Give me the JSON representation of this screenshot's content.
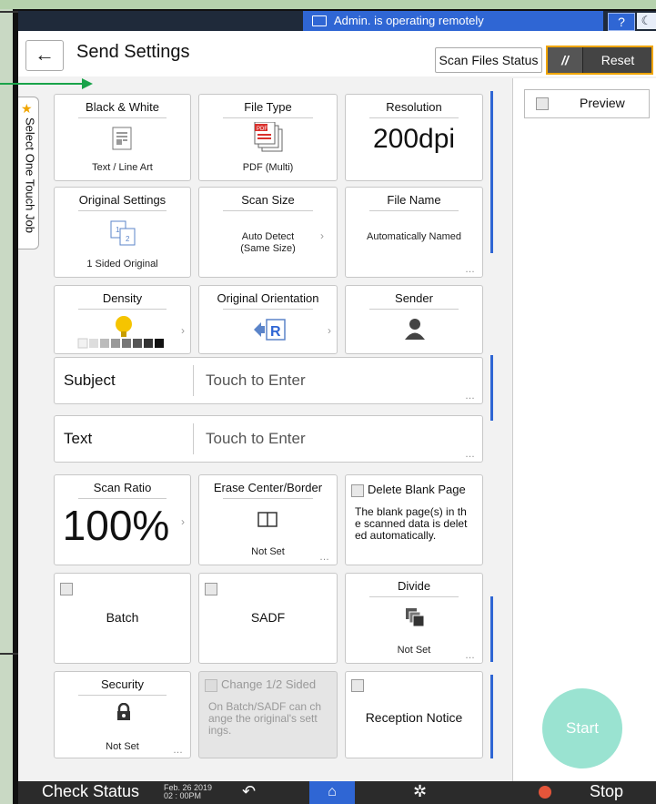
{
  "status_bar": {
    "remote_text": "Admin. is operating remotely",
    "help": "?",
    "moon": "☾"
  },
  "header": {
    "back": "←",
    "title": "Send Settings",
    "scan_files_status": "Scan Files Status",
    "reset": "Reset"
  },
  "side_tab": {
    "label": "Select One Touch Job"
  },
  "tiles": {
    "bw": {
      "title": "Black & White",
      "sub": "Text / Line Art"
    },
    "filetype": {
      "title": "File Type",
      "sub": "PDF (Multi)",
      "pdf": "PDF"
    },
    "resolution": {
      "title": "Resolution",
      "value": "200dpi"
    },
    "original": {
      "title": "Original Settings",
      "sub": "1 Sided Original",
      "n1": "1",
      "n2": "2"
    },
    "scansize": {
      "title": "Scan Size",
      "sub1": "Auto Detect",
      "sub2": "(Same Size)"
    },
    "filename": {
      "title": "File Name",
      "sub": "Automatically Named"
    },
    "density": {
      "title": "Density"
    },
    "orientation": {
      "title": "Original Orientation",
      "glyph": "R"
    },
    "sender": {
      "title": "Sender"
    },
    "scanratio": {
      "title": "Scan Ratio",
      "value": "100%"
    },
    "erase": {
      "title": "Erase Center/Border",
      "sub": "Not Set"
    },
    "deleteblank": {
      "title": "Delete Blank Page",
      "desc1": "The blank page(s) in th",
      "desc2": "e scanned data is delet",
      "desc3": "ed automatically."
    },
    "batch": {
      "title": "Batch"
    },
    "sadf": {
      "title": "SADF"
    },
    "divide": {
      "title": "Divide",
      "sub": "Not Set"
    },
    "security": {
      "title": "Security",
      "sub": "Not Set"
    },
    "change12": {
      "title": "Change 1/2 Sided",
      "desc1": "On Batch/SADF can ch",
      "desc2": "ange the original's sett",
      "desc3": "ings."
    },
    "reception": {
      "title": "Reception Notice"
    }
  },
  "fields": {
    "subject": {
      "label": "Subject",
      "value": "Touch to Enter"
    },
    "text": {
      "label": "Text",
      "value": "Touch to Enter"
    }
  },
  "preview": {
    "label": "Preview"
  },
  "start": {
    "label": "Start"
  },
  "bottom": {
    "check_status": "Check Status",
    "date": "Feb. 26 2019",
    "time": "02 : 00PM",
    "stop": "Stop"
  },
  "colors": {
    "accent": "#2f66d4",
    "reset_border": "#f0a500",
    "start": "#9ae3d1",
    "stop": "#e4553a"
  }
}
